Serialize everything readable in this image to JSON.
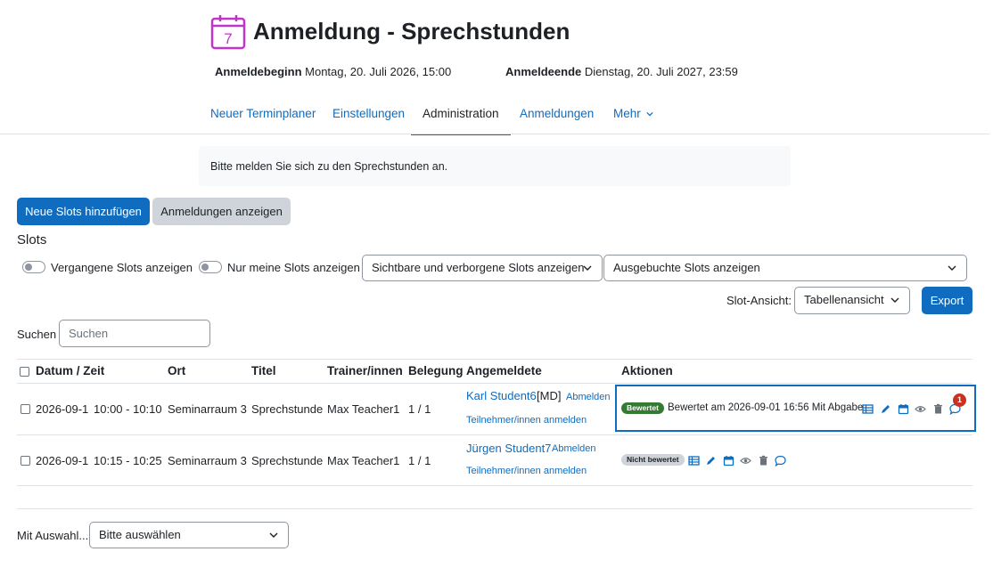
{
  "header": {
    "icon_day": "7",
    "title": "Anmeldung - Sprechstunden",
    "start_label": "Anmeldebeginn",
    "start_value": "Montag, 20. Juli 2026, 15:00",
    "end_label": "Anmeldeende",
    "end_value": "Dienstag, 20. Juli 2027, 23:59"
  },
  "tabs": [
    {
      "label": "Neuer Terminplaner"
    },
    {
      "label": "Einstellungen"
    },
    {
      "label": "Administration",
      "active": true
    },
    {
      "label": "Anmeldungen"
    },
    {
      "label": "Mehr"
    }
  ],
  "intro": "Bitte melden Sie sich zu den Sprechstunden an.",
  "buttons": {
    "add_slots": "Neue Slots hinzufügen",
    "show_bookings": "Anmeldungen anzeigen",
    "export": "Export"
  },
  "slots_title": "Slots",
  "filters": {
    "past_slots": "Vergangene Slots anzeigen",
    "my_slots": "Nur meine Slots anzeigen",
    "visibility_select": "Sichtbare und verborgene Slots anzeigen",
    "booked_select": "Ausgebuchte Slots anzeigen",
    "view_label": "Slot-Ansicht:",
    "view_select": "Tabellenansicht"
  },
  "search": {
    "label": "Suchen",
    "placeholder": "Suchen"
  },
  "table": {
    "headers": {
      "datetime": "Datum / Zeit",
      "location": "Ort",
      "title": "Titel",
      "trainer": "Trainer/innen",
      "occupancy": "Belegung",
      "registered": "Angemeldete",
      "actions": "Aktionen"
    },
    "rows": [
      {
        "date": "2026-09-1",
        "time": "10:00 - 10:10",
        "location": "Seminarraum 3",
        "title": "Sprechstunde",
        "trainer": "Max Teacher1",
        "occupancy": "1 / 1",
        "student": "Karl Student6",
        "student_suffix": "[MD]",
        "unregister": "Abmelden",
        "enrol_link": "Teilnehmer/innen anmelden",
        "status": "Bewertet",
        "status_text": "Bewertet am 2026-09-01 16:56 Mit Abgabe",
        "comment_count": "1"
      },
      {
        "date": "2026-09-1",
        "time": "10:15 - 10:25",
        "location": "Seminarraum 3",
        "title": "Sprechstunde",
        "trainer": "Max Teacher1",
        "occupancy": "1 / 1",
        "student": "Jürgen Student7",
        "unregister": "Abmelden",
        "enrol_link": "Teilnehmer/innen anmelden",
        "status": "Nicht bewertet"
      }
    ]
  },
  "with_selection": {
    "label": "Mit Auswahl...",
    "select": "Bitte auswählen"
  },
  "icons": [
    "calendar-icon",
    "chevron-down-icon",
    "table-icon",
    "pencil-icon",
    "calendar-small-icon",
    "eye-icon",
    "trash-icon",
    "comment-icon"
  ],
  "colors": {
    "accent": "#0f6cbf",
    "success": "#357a32",
    "danger": "#ca3120",
    "title_icon": "#c133c9"
  }
}
